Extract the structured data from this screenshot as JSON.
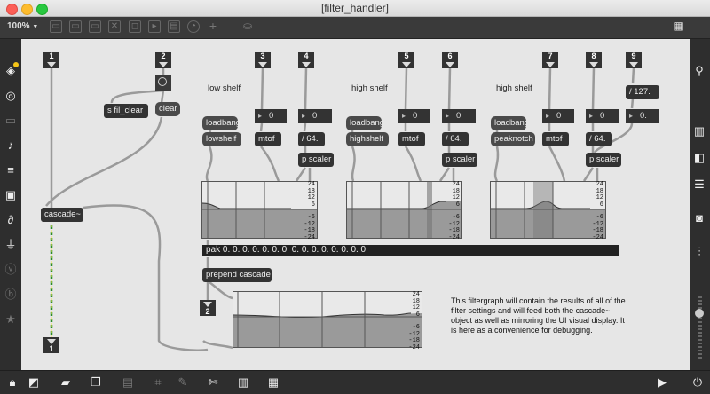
{
  "window": {
    "title": "[filter_handler]"
  },
  "toolbar": {
    "zoom": "100%",
    "zoom_arrow": "▼"
  },
  "patch": {
    "inlets": [
      {
        "n": "1"
      },
      {
        "n": "2"
      },
      {
        "n": "3"
      },
      {
        "n": "4"
      },
      {
        "n": "5"
      },
      {
        "n": "6"
      },
      {
        "n": "7"
      },
      {
        "n": "8"
      },
      {
        "n": "9"
      }
    ],
    "outlets": [
      {
        "n": "1"
      },
      {
        "n": "2"
      }
    ],
    "sections": [
      "low shelf",
      "high shelf",
      "high shelf"
    ],
    "objects": {
      "s_fil_clear": "s fil_clear",
      "clear": "clear",
      "cascade": "cascade~",
      "loadbang": "loadbang",
      "lowshelf": "lowshelf",
      "highshelf": "highshelf",
      "peaknotch": "peaknotch",
      "mtof": "mtof",
      "div64": "/ 64.",
      "div127": "/ 127.",
      "p_scaler": "p scaler",
      "pak": "pak 0. 0. 0. 0. 0. 0. 0. 0. 0. 0. 0. 0. 0. 0. 0.",
      "prepend": "prepend cascade"
    },
    "numbers": {
      "zero": "0",
      "zero_float": "0."
    },
    "graph_ticks": [
      "24",
      "18",
      "12",
      "6",
      "-6",
      "-12",
      "-18",
      "-24"
    ],
    "comment": "This filtergraph will contain the results of all of the filter settings and will feed both the cascade~ object as well as mirroring the UI visual display.  It is here as a convenience for debugging."
  },
  "icons": {
    "left": [
      "cube-icon",
      "target-icon",
      "toolbox-icon",
      "note-icon",
      "playlist-icon",
      "image-icon",
      "paperclip-icon",
      "plug-icon",
      "v-circle-icon",
      "b-circle-icon",
      "star-icon"
    ],
    "right": [
      "search-icon",
      "book-icon",
      "sidebar-icon",
      "list-icon",
      "camera-icon",
      "sliders-icon",
      "power-icon"
    ],
    "bottom": [
      "lock-icon",
      "edit-icon",
      "comment-icon",
      "windows-icon",
      "present-icon",
      "debug-icon",
      "wrench-icon",
      "piano-icon",
      "grid-icon",
      "play-icon"
    ]
  },
  "colors": {
    "accent_yellow": "#f5c518",
    "canvas_bg": "#e6e6e6",
    "object_bg": "#333333"
  }
}
